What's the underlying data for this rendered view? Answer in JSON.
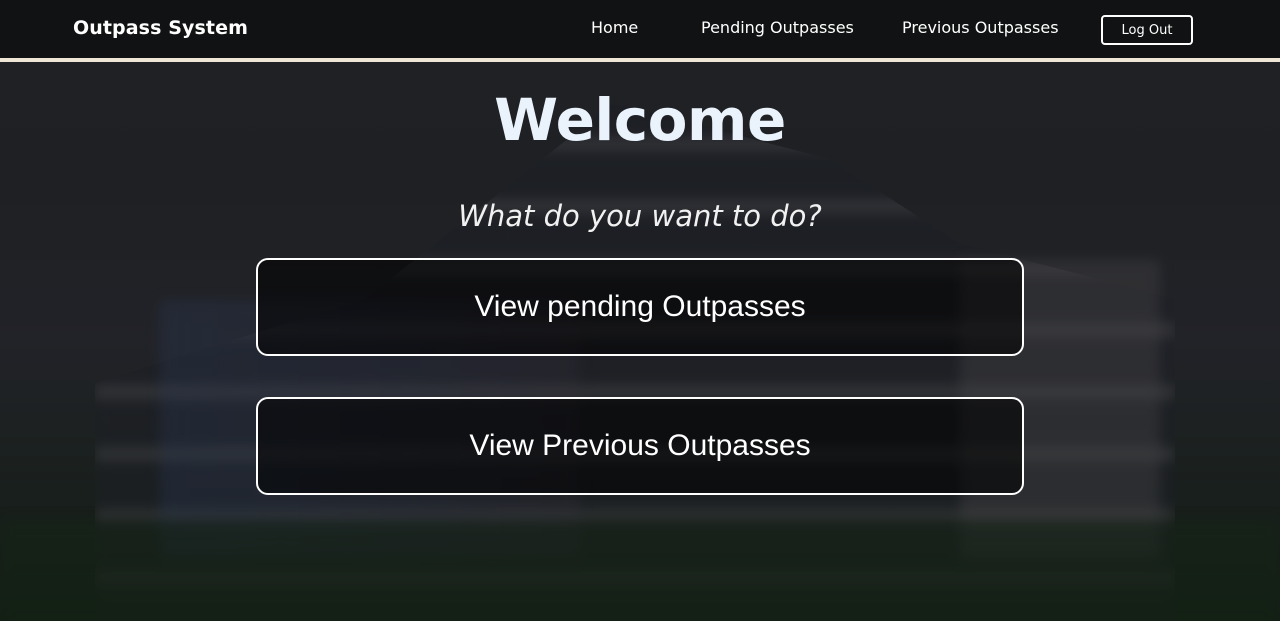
{
  "navbar": {
    "brand": "Outpass System",
    "links": [
      {
        "label": "Home"
      },
      {
        "label": "Pending Outpasses"
      },
      {
        "label": "Previous Outpasses"
      }
    ],
    "logout_label": "Log Out"
  },
  "main": {
    "title": "Welcome",
    "subtitle": "What do you want to do?",
    "actions": [
      {
        "label": "View pending Outpasses"
      },
      {
        "label": "View Previous Outpasses"
      }
    ]
  },
  "colors": {
    "navbar_bg": "#111213",
    "navbar_border": "#f0e6d6",
    "title_text": "#eaf2fb",
    "button_border": "#ffffff"
  }
}
